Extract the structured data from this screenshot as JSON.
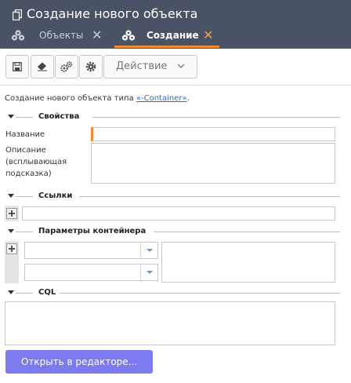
{
  "window": {
    "title": "Создание нового объекта",
    "tabs": [
      {
        "label": "Объекты",
        "icon": "cubes-icon",
        "active": false
      },
      {
        "label": "Создание",
        "icon": "cubes-icon",
        "active": true
      }
    ]
  },
  "toolbar": {
    "buttons": [
      "save-icon",
      "eraser-icon",
      "settings-gears-icon",
      "gear-icon"
    ],
    "action_label": "Действие"
  },
  "form": {
    "intro_text": "Создание нового объекта типа ",
    "intro_link": "«-Container»",
    "intro_suffix": ".",
    "sections": {
      "properties": "Свойства",
      "links": "Ссылки",
      "container_params": "Параметры контейнера",
      "cql": "CQL"
    },
    "fields": {
      "name_label": "Название",
      "name_value": "",
      "description_label_1": "Описание",
      "description_label_2": "(всплывающая",
      "description_label_3": "подсказка)",
      "description_value": ""
    },
    "open_editor_label": "Открыть в редакторе..."
  },
  "colors": {
    "header_bg": "#4a5366",
    "accent_orange": "#f08c2e",
    "button_purple": "#7d7af0",
    "link_blue": "#2c6fb7"
  }
}
